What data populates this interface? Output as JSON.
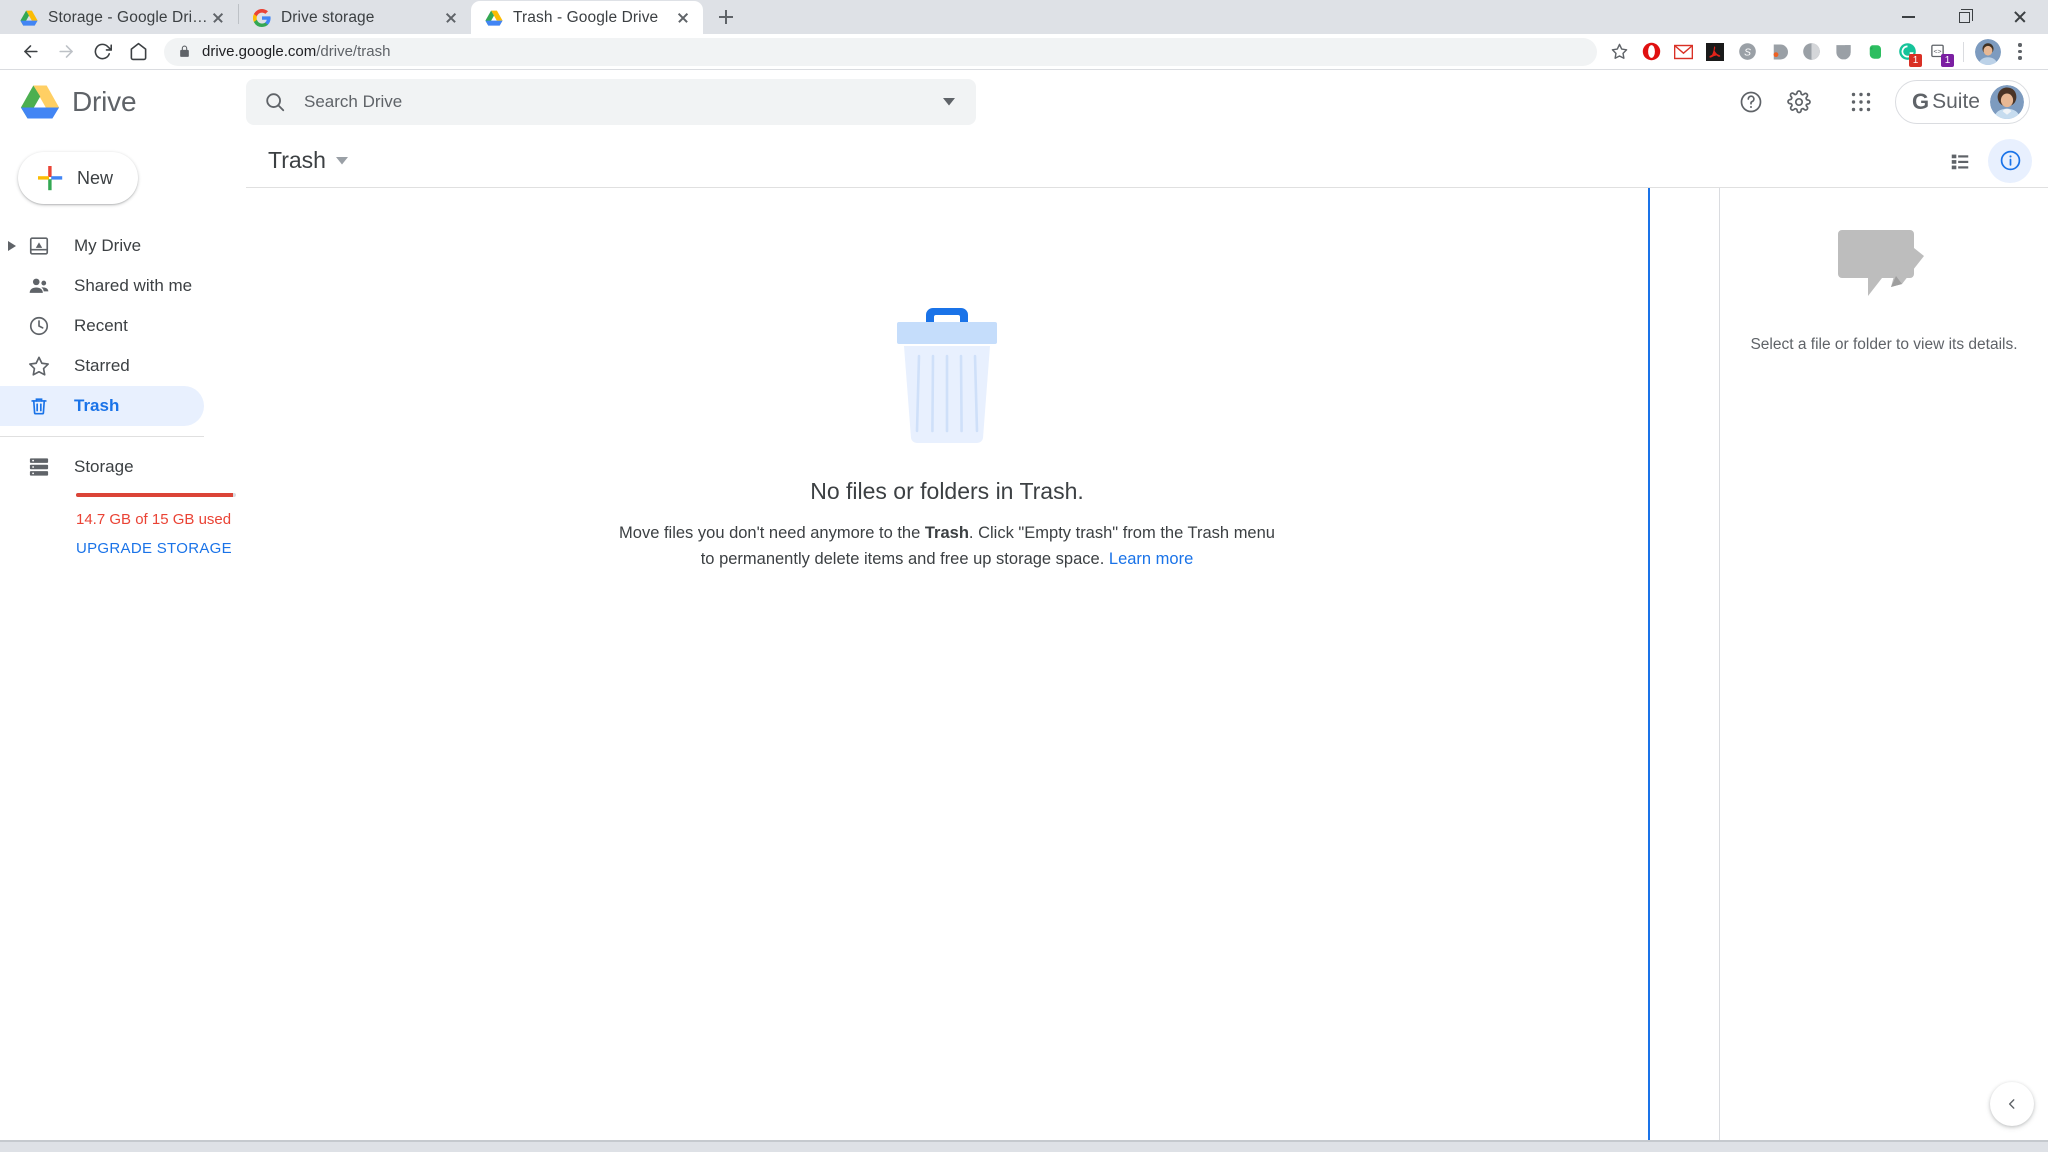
{
  "browser": {
    "tabs": [
      {
        "title": "Storage - Google Drive",
        "favicon": "drive-icon",
        "active": false
      },
      {
        "title": "Drive storage",
        "favicon": "google-g-icon",
        "active": false
      },
      {
        "title": "Trash - Google Drive",
        "favicon": "drive-icon",
        "active": true
      }
    ],
    "new_tab_label": "New tab",
    "url_domain": "drive.google.com",
    "url_path": "/drive/trash",
    "extensions": [
      {
        "name": "opera-icon",
        "badge": ""
      },
      {
        "name": "gmail-icon",
        "badge": ""
      },
      {
        "name": "adobe-acrobat-icon",
        "badge": ""
      },
      {
        "name": "skype-icon",
        "badge": ""
      },
      {
        "name": "bitly-icon",
        "badge": ""
      },
      {
        "name": "ghostery-icon",
        "badge": ""
      },
      {
        "name": "pocket-icon",
        "badge": ""
      },
      {
        "name": "evernote-icon",
        "badge": ""
      },
      {
        "name": "grammarly-icon",
        "badge": "1"
      },
      {
        "name": "code-snippet-icon",
        "badge": "1"
      }
    ],
    "window_controls": {
      "minimize": "Minimize",
      "maximize": "Maximize",
      "close": "Close"
    }
  },
  "header": {
    "product_name": "Drive",
    "search_placeholder": "Search Drive",
    "search_value": "",
    "help_label": "Support",
    "settings_label": "Settings",
    "apps_label": "Google apps",
    "account_brand": "Suite",
    "account_brand_g": "G"
  },
  "sidebar": {
    "new_button": "New",
    "items": [
      {
        "label": "My Drive",
        "icon": "my-drive-icon",
        "active": false,
        "expandable": true
      },
      {
        "label": "Shared with me",
        "icon": "people-icon",
        "active": false,
        "expandable": false
      },
      {
        "label": "Recent",
        "icon": "clock-icon",
        "active": false,
        "expandable": false
      },
      {
        "label": "Starred",
        "icon": "star-icon",
        "active": false,
        "expandable": false
      },
      {
        "label": "Trash",
        "icon": "trash-icon",
        "active": true,
        "expandable": false
      }
    ],
    "storage": {
      "label": "Storage",
      "used_text": "14.7 GB of 15 GB used",
      "upgrade_label": "UPGRADE STORAGE",
      "percent_used": 98,
      "bar_color": "#db4437",
      "text_color": "#ea4335",
      "link_color": "#1a73e8"
    }
  },
  "main": {
    "breadcrumb": "Trash",
    "view_toggle_label": "List view",
    "details_toggle_label": "View details",
    "empty_state": {
      "title": "No files or folders in Trash.",
      "desc_part1": "Move files you don't need anymore to the ",
      "desc_bold": "Trash",
      "desc_part2": ". Click \"Empty trash\" from the Trash menu to permanently delete items and free up storage space. ",
      "learn_more": "Learn more"
    }
  },
  "details_panel": {
    "message": "Select a file or folder to view its details.",
    "collapse_label": "Collapse"
  },
  "colors": {
    "accent_blue": "#1a73e8",
    "active_nav_bg": "#e8f0fe",
    "storage_red": "#db4437",
    "chrome_tabstrip": "#dee1e6"
  }
}
